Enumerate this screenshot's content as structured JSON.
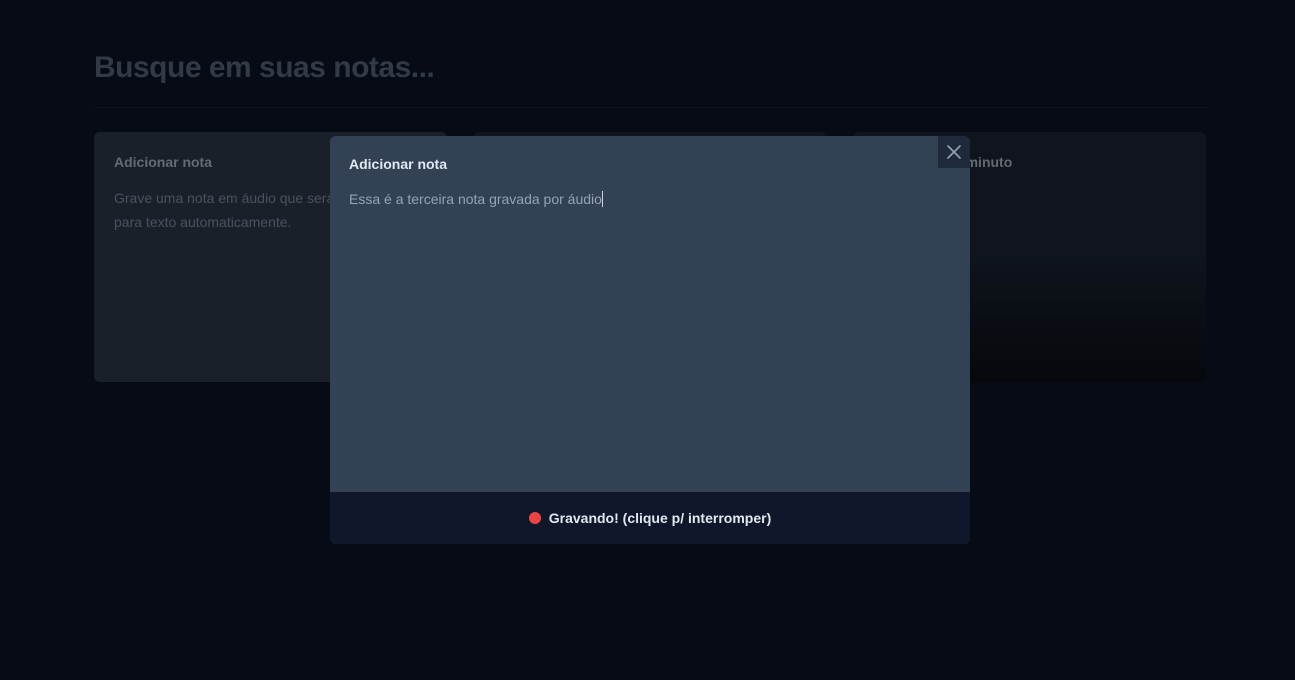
{
  "search": {
    "placeholder": "Busque em suas notas..."
  },
  "cards": {
    "add": {
      "title": "Adicionar nota",
      "text": "Grave uma nota em áudio que será convertida para texto automaticamente."
    },
    "note": {
      "title": "há cerca de 1 minuto",
      "text": ""
    }
  },
  "modal": {
    "title": "Adicionar nota",
    "content": "Essa é a terceira nota gravada por áudio",
    "record_label": "Gravando! (clique p/ interromper)",
    "close_icon": "x-icon"
  },
  "colors": {
    "background": "#0f172a",
    "card": "#334155",
    "modal": "#334155",
    "recording_dot": "#ef4444"
  }
}
